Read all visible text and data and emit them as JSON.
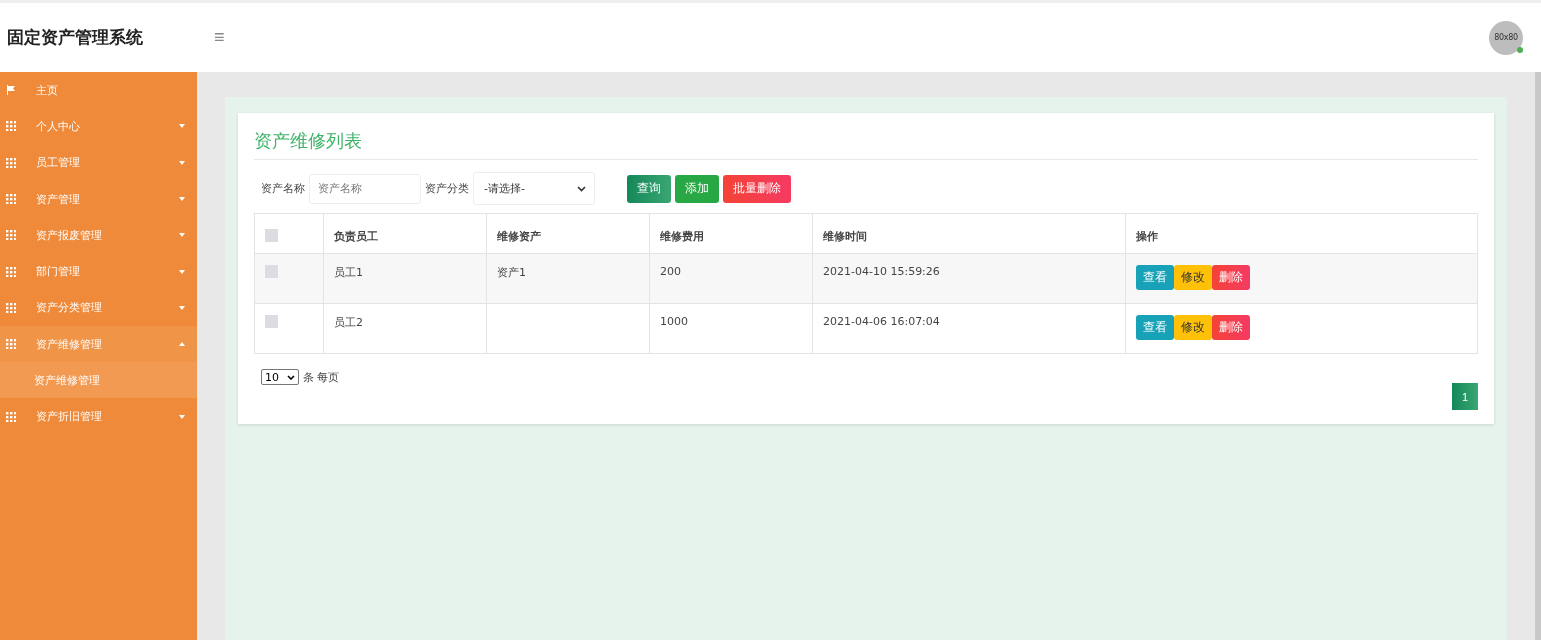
{
  "app_title": "固定资产管理系统",
  "header": {
    "menu_toggle": "≡",
    "avatar_text": "80x80",
    "online": true
  },
  "sidebar": {
    "items": [
      {
        "label": "主页",
        "kind": "flag",
        "has_children": false,
        "expanded": false,
        "selected": false
      },
      {
        "label": "个人中心",
        "kind": "grid",
        "has_children": true,
        "expanded": false,
        "selected": false
      },
      {
        "label": "员工管理",
        "kind": "grid",
        "has_children": true,
        "expanded": false,
        "selected": false
      },
      {
        "label": "资产管理",
        "kind": "grid",
        "has_children": true,
        "expanded": false,
        "selected": false
      },
      {
        "label": "资产报废管理",
        "kind": "grid",
        "has_children": true,
        "expanded": false,
        "selected": false
      },
      {
        "label": "部门管理",
        "kind": "grid",
        "has_children": true,
        "expanded": false,
        "selected": false
      },
      {
        "label": "资产分类管理",
        "kind": "grid",
        "has_children": true,
        "expanded": false,
        "selected": false
      },
      {
        "label": "资产维修管理",
        "kind": "grid",
        "has_children": true,
        "expanded": true,
        "selected": true,
        "children": [
          {
            "label": "资产维修管理",
            "selected": true
          }
        ]
      },
      {
        "label": "资产折旧管理",
        "kind": "grid",
        "has_children": true,
        "expanded": false,
        "selected": false
      }
    ]
  },
  "page_title": "资产维修列表",
  "filters": {
    "name_label": "资产名称",
    "name_placeholder": "资产名称",
    "category_label": "资产分类",
    "category_value": "-请选择-"
  },
  "actions": [
    {
      "label": "查询",
      "kind": "query"
    },
    {
      "label": "添加",
      "kind": "add"
    },
    {
      "label": "批量删除",
      "kind": "delete"
    }
  ],
  "table": {
    "select_all_checked": false,
    "columns": [
      "负责员工",
      "维修资产",
      "维修费用",
      "维修时间",
      "操作"
    ],
    "rows": [
      {
        "checked": false,
        "cells": [
          "员工1",
          "资产1",
          "200",
          "2021-04-10 15:59:26"
        ],
        "buttons": [
          {
            "label": "查看",
            "kind": "view"
          },
          {
            "label": "修改",
            "kind": "edit"
          },
          {
            "label": "删除",
            "kind": "delete"
          }
        ]
      },
      {
        "checked": false,
        "cells": [
          "员工2",
          "",
          "1000",
          "2021-04-06 16:07:04"
        ],
        "buttons": [
          {
            "label": "查看",
            "kind": "view"
          },
          {
            "label": "修改",
            "kind": "edit"
          },
          {
            "label": "删除",
            "kind": "delete"
          }
        ]
      }
    ]
  },
  "page_size": {
    "value": "10",
    "suffix": "条 每页"
  },
  "pagination": [
    {
      "label": "1",
      "selected": true
    }
  ]
}
